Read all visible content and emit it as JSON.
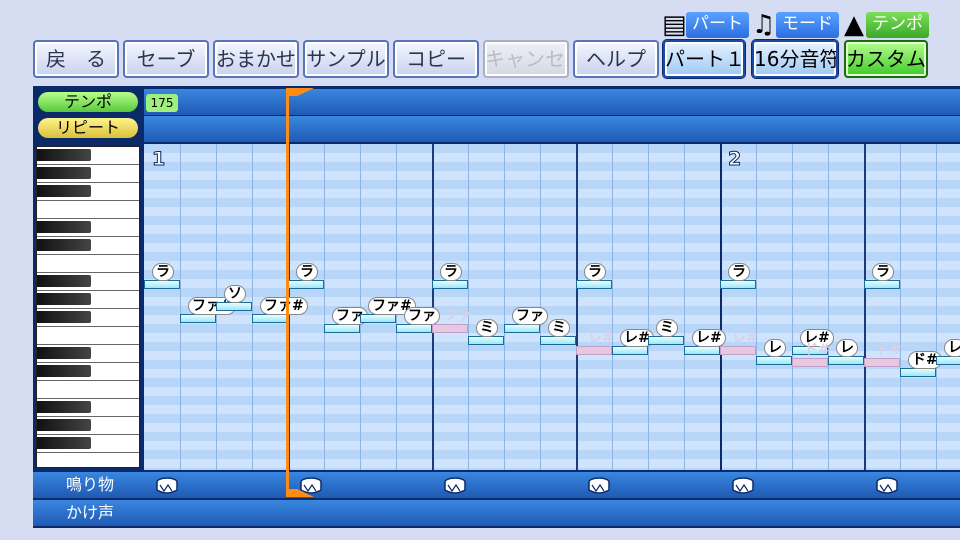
{
  "toolbar": {
    "buttons": [
      "戻　る",
      "セーブ",
      "おまかせ",
      "サンプル",
      "コピー",
      "キャンセル",
      "ヘルプ"
    ]
  },
  "modes": {
    "part_label": "パート",
    "mode_label": "モード",
    "tempo_label": "テンポ",
    "part_value": "パート１",
    "mode_value": "16分音符",
    "tempo_value": "カスタム"
  },
  "rows": {
    "tempo_label": "テンポ",
    "repeat_label": "リピート",
    "tempo_number": "175",
    "sound_label": "鳴り物",
    "voice_label": "かけ声"
  },
  "measures": [
    "1",
    "2"
  ],
  "notes": [
    {
      "label": "ラ",
      "ghost": false
    },
    {
      "label": "ファ#",
      "ghost": false
    },
    {
      "label": "ソ",
      "ghost": false
    },
    {
      "label": "ファ#",
      "ghost": false
    },
    {
      "label": "ラ",
      "ghost": false
    },
    {
      "label": "ファ",
      "ghost": false
    },
    {
      "label": "ファ#",
      "ghost": false
    },
    {
      "label": "ファ",
      "ghost": false
    },
    {
      "label": "ラ",
      "ghost": false
    },
    {
      "label": "ファ",
      "ghost": true
    },
    {
      "label": "ミ",
      "ghost": false
    },
    {
      "label": "ファ",
      "ghost": false
    },
    {
      "label": "ミ",
      "ghost": false
    },
    {
      "label": "ラ",
      "ghost": false
    },
    {
      "label": "レ#",
      "ghost": true
    },
    {
      "label": "レ#",
      "ghost": false
    },
    {
      "label": "ミ",
      "ghost": false
    },
    {
      "label": "レ#",
      "ghost": false
    },
    {
      "label": "ラ",
      "ghost": false
    },
    {
      "label": "レ#",
      "ghost": true
    },
    {
      "label": "レ",
      "ghost": false
    },
    {
      "label": "レ#",
      "ghost": false
    },
    {
      "label": "ド#",
      "ghost": true
    },
    {
      "label": "レ",
      "ghost": false
    },
    {
      "label": "ラ",
      "ghost": false
    },
    {
      "label": "ド#",
      "ghost": true
    },
    {
      "label": "ド#",
      "ghost": false
    },
    {
      "label": "レ",
      "ghost": false
    }
  ]
}
